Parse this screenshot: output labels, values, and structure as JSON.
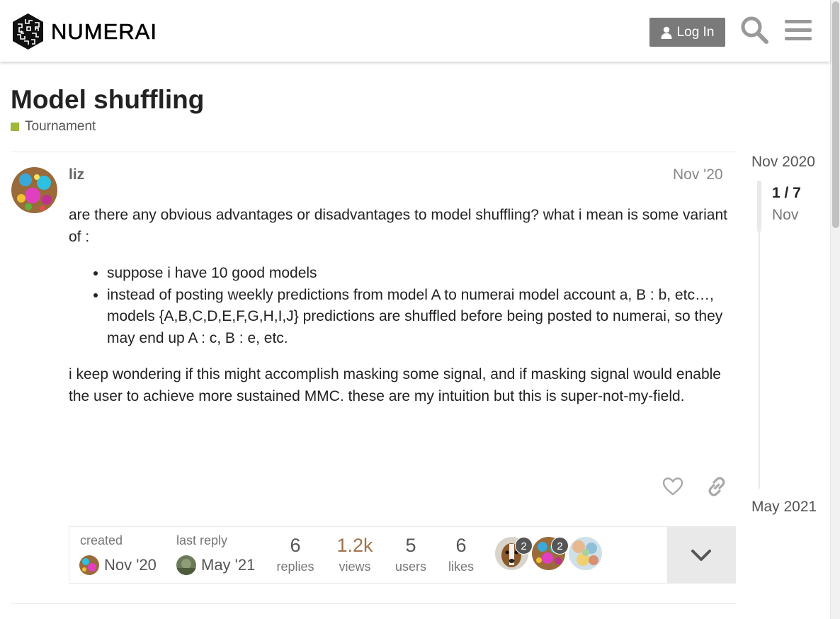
{
  "header": {
    "logo_text": "NUMERAI",
    "login_label": "Log In",
    "icons": [
      "user-icon",
      "search-icon",
      "hamburger-menu-icon"
    ]
  },
  "topic": {
    "title": "Model shuffling",
    "category": "Tournament",
    "category_color": "#9eb83b"
  },
  "post": {
    "username": "liz",
    "date": "Nov '20",
    "paragraph1": "are there any obvious advantages or disadvantages to model shuffling? what i mean is some variant of :",
    "bullets": [
      "suppose i have 10 good models",
      "instead of posting weekly predictions from model A to numerai model account a, B : b, etc…, models {A,B,C,D,E,F,G,H,I,J} predictions are shuffled before being posted to numerai, so they may end up A : c, B : e, etc."
    ],
    "paragraph2": "i keep wondering if this might accomplish masking some signal, and if masking signal would enable the user to achieve more sustained MMC. these are my intuition but this is super-not-my-field.",
    "action_icons": [
      "heart-icon",
      "link-icon"
    ]
  },
  "topic_map": {
    "created_label": "created",
    "created_date": "Nov '20",
    "last_reply_label": "last reply",
    "last_reply_date": "May '21",
    "replies": "6",
    "replies_label": "replies",
    "views": "1.2k",
    "views_label": "views",
    "views_color": "#a0734a",
    "users": "5",
    "users_label": "users",
    "likes": "6",
    "likes_label": "likes",
    "participant_counts": [
      "2",
      "2"
    ]
  },
  "timeline": {
    "start": "Nov 2020",
    "position": "1 / 7",
    "position_date": "Nov",
    "end": "May 2021"
  }
}
